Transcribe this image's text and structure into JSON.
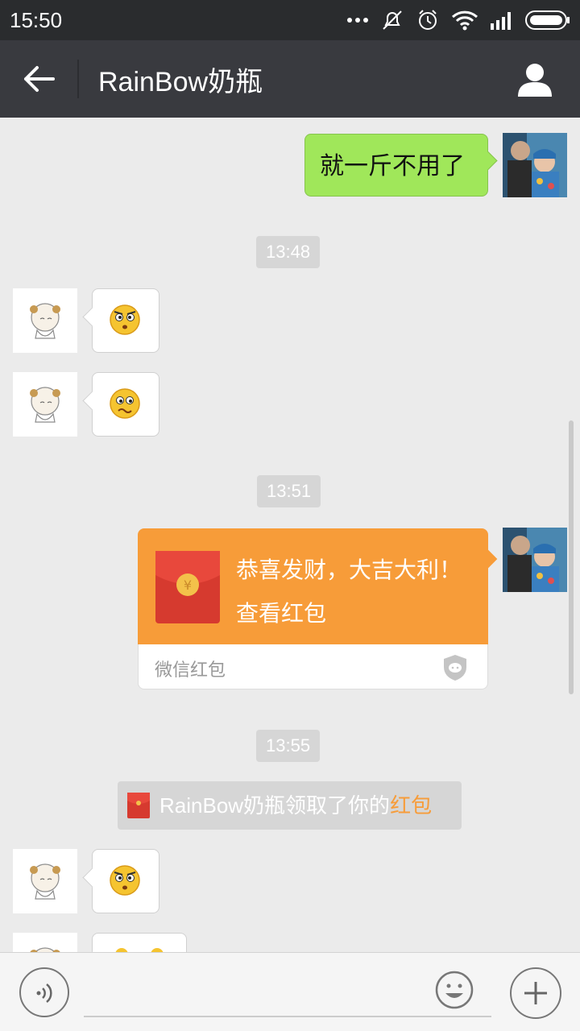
{
  "status": {
    "time": "15:50"
  },
  "header": {
    "title": "RainBow奶瓶"
  },
  "messages": {
    "sent_text": "就一斤不用了",
    "time1": "13:48",
    "time2": "13:51",
    "time3": "13:55",
    "red_packet": {
      "greeting": "恭喜发财，大吉大利！",
      "action": "查看红包",
      "brand": "微信红包"
    },
    "system": {
      "prefix": "RainBow奶瓶领取了你的",
      "highlight": "红包"
    }
  },
  "colors": {
    "titlebar": "#393a3f",
    "statusbar": "#2a2c2e",
    "chat_bg": "#ebebeb",
    "sent_bubble": "#a0e75a",
    "red_packet": "#f79c39",
    "accent": "#f79c39"
  },
  "icons": [
    "back-arrow-icon",
    "profile-icon",
    "wifi-icon",
    "signal-icon",
    "battery-icon",
    "alarm-icon",
    "mute-icon",
    "voice-icon",
    "emoji-icon",
    "plus-icon",
    "shield-icon",
    "red-envelope-icon",
    "angry-face-icon",
    "worried-face-icon"
  ]
}
